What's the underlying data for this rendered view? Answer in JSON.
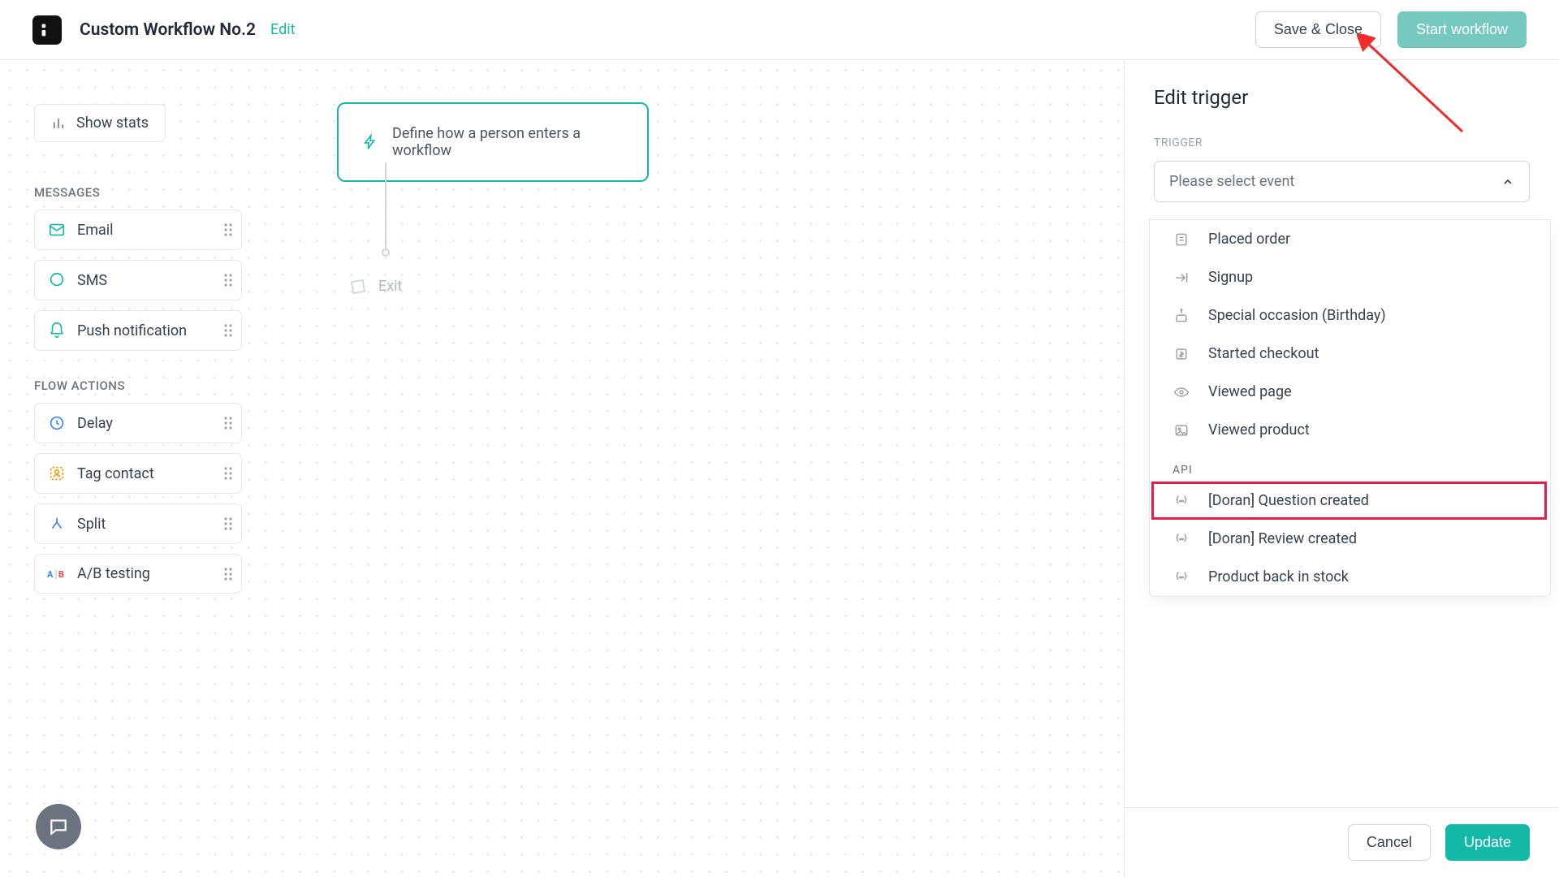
{
  "header": {
    "title": "Custom Workflow No.2",
    "edit_label": "Edit",
    "save_label": "Save & Close",
    "start_label": "Start workflow"
  },
  "stats_button": "Show stats",
  "palette": {
    "messages_heading": "MESSAGES",
    "messages": [
      {
        "label": "Email",
        "icon": "mail-icon"
      },
      {
        "label": "SMS",
        "icon": "chat-icon"
      },
      {
        "label": "Push notification",
        "icon": "bell-icon"
      }
    ],
    "flow_heading": "FLOW ACTIONS",
    "flow": [
      {
        "label": "Delay",
        "icon": "clock-icon"
      },
      {
        "label": "Tag contact",
        "icon": "tag-person-icon"
      },
      {
        "label": "Split",
        "icon": "split-icon"
      },
      {
        "label": "A/B testing",
        "icon": "ab-icon"
      }
    ]
  },
  "trigger_node": "Define how a person enters a workflow",
  "exit_label": "Exit",
  "right_panel": {
    "title": "Edit trigger",
    "section_label": "TRIGGER",
    "select_placeholder": "Please select event",
    "options": [
      {
        "label": "Placed order",
        "icon": "receipt-icon",
        "highlighted": false
      },
      {
        "label": "Signup",
        "icon": "enter-icon",
        "highlighted": false
      },
      {
        "label": "Special occasion (Birthday)",
        "icon": "cake-icon",
        "highlighted": false
      },
      {
        "label": "Started checkout",
        "icon": "dollar-icon",
        "highlighted": false
      },
      {
        "label": "Viewed page",
        "icon": "eye-icon",
        "highlighted": false
      },
      {
        "label": "Viewed product",
        "icon": "image-icon",
        "highlighted": false
      }
    ],
    "api_group_label": "API",
    "api_options": [
      {
        "label": "[Doran] Question created",
        "icon": "braces-icon",
        "highlighted": true
      },
      {
        "label": "[Doran] Review created",
        "icon": "braces-icon",
        "highlighted": false
      },
      {
        "label": "Product back in stock",
        "icon": "braces-icon",
        "highlighted": false
      }
    ],
    "cancel_label": "Cancel",
    "update_label": "Update"
  }
}
